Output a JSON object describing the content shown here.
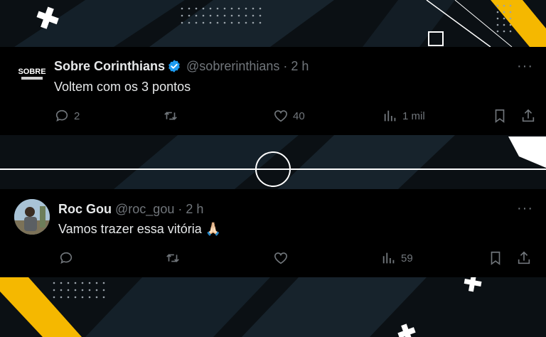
{
  "tweets": [
    {
      "name": "Sobre Corinthians",
      "handle": "@sobrerinthians",
      "time": "· 2 h",
      "text": "Voltem com os 3 pontos",
      "avatar_text": "SOBRE",
      "replies": "2",
      "retweets": "",
      "likes": "40",
      "views": "1 mil"
    },
    {
      "name": "Roc Gou",
      "handle": "@roc_gou",
      "time": "· 2 h",
      "text": "Vamos trazer essa vitória 🙏🏻",
      "replies": "",
      "retweets": "",
      "likes": "",
      "views": "59"
    }
  ],
  "more_label": "···",
  "colors": {
    "accent_yellow": "#f5b800",
    "verified_blue": "#1d9bf0",
    "text_primary": "#e7e9ea",
    "text_secondary": "#71767b"
  }
}
